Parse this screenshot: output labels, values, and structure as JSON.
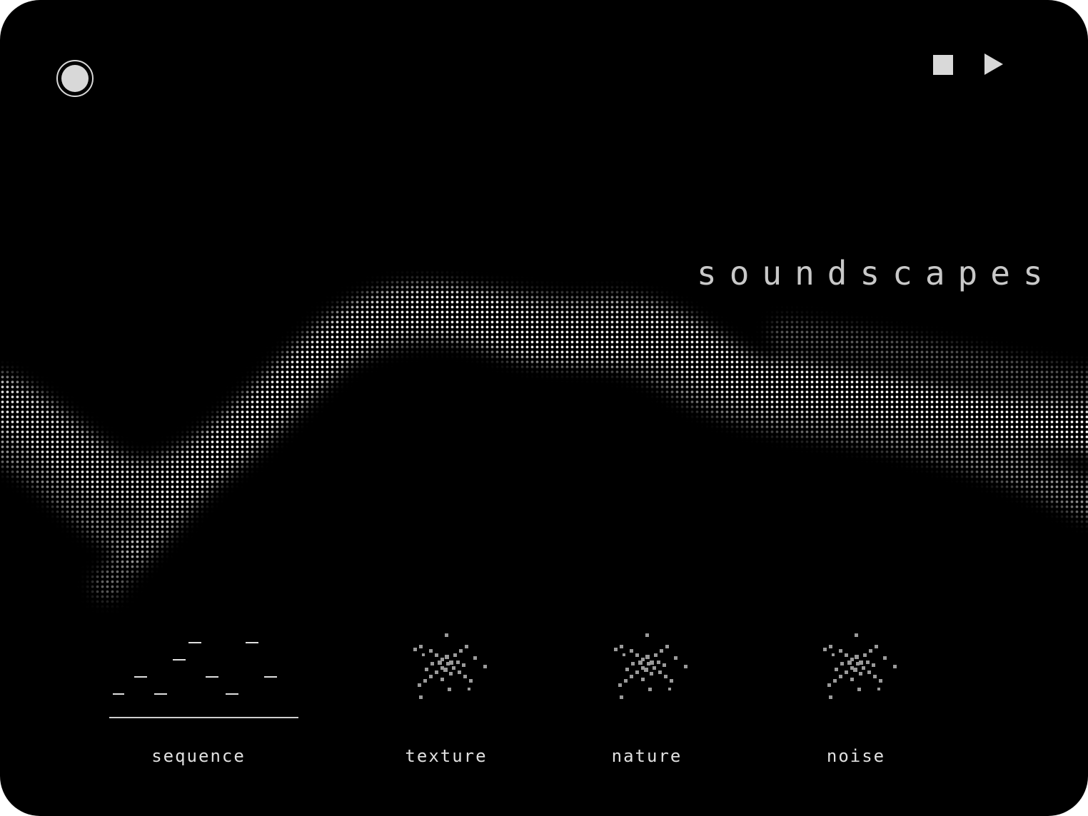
{
  "app": {
    "title": "soundscapes"
  },
  "transport": {
    "record_icon": "record-icon",
    "stop_icon": "stop-icon",
    "play_icon": "play-icon"
  },
  "modes": [
    {
      "label": "sequence",
      "icon": "sequence-steps-icon",
      "selected": true
    },
    {
      "label": "texture",
      "icon": "pixel-sparkle-icon",
      "selected": false
    },
    {
      "label": "nature",
      "icon": "pixel-sparkle-icon",
      "selected": false
    },
    {
      "label": "noise",
      "icon": "pixel-sparkle-icon",
      "selected": false
    }
  ],
  "colors": {
    "background": "#000000",
    "foreground": "#d9d9d9",
    "dim": "#8a8a8a"
  }
}
